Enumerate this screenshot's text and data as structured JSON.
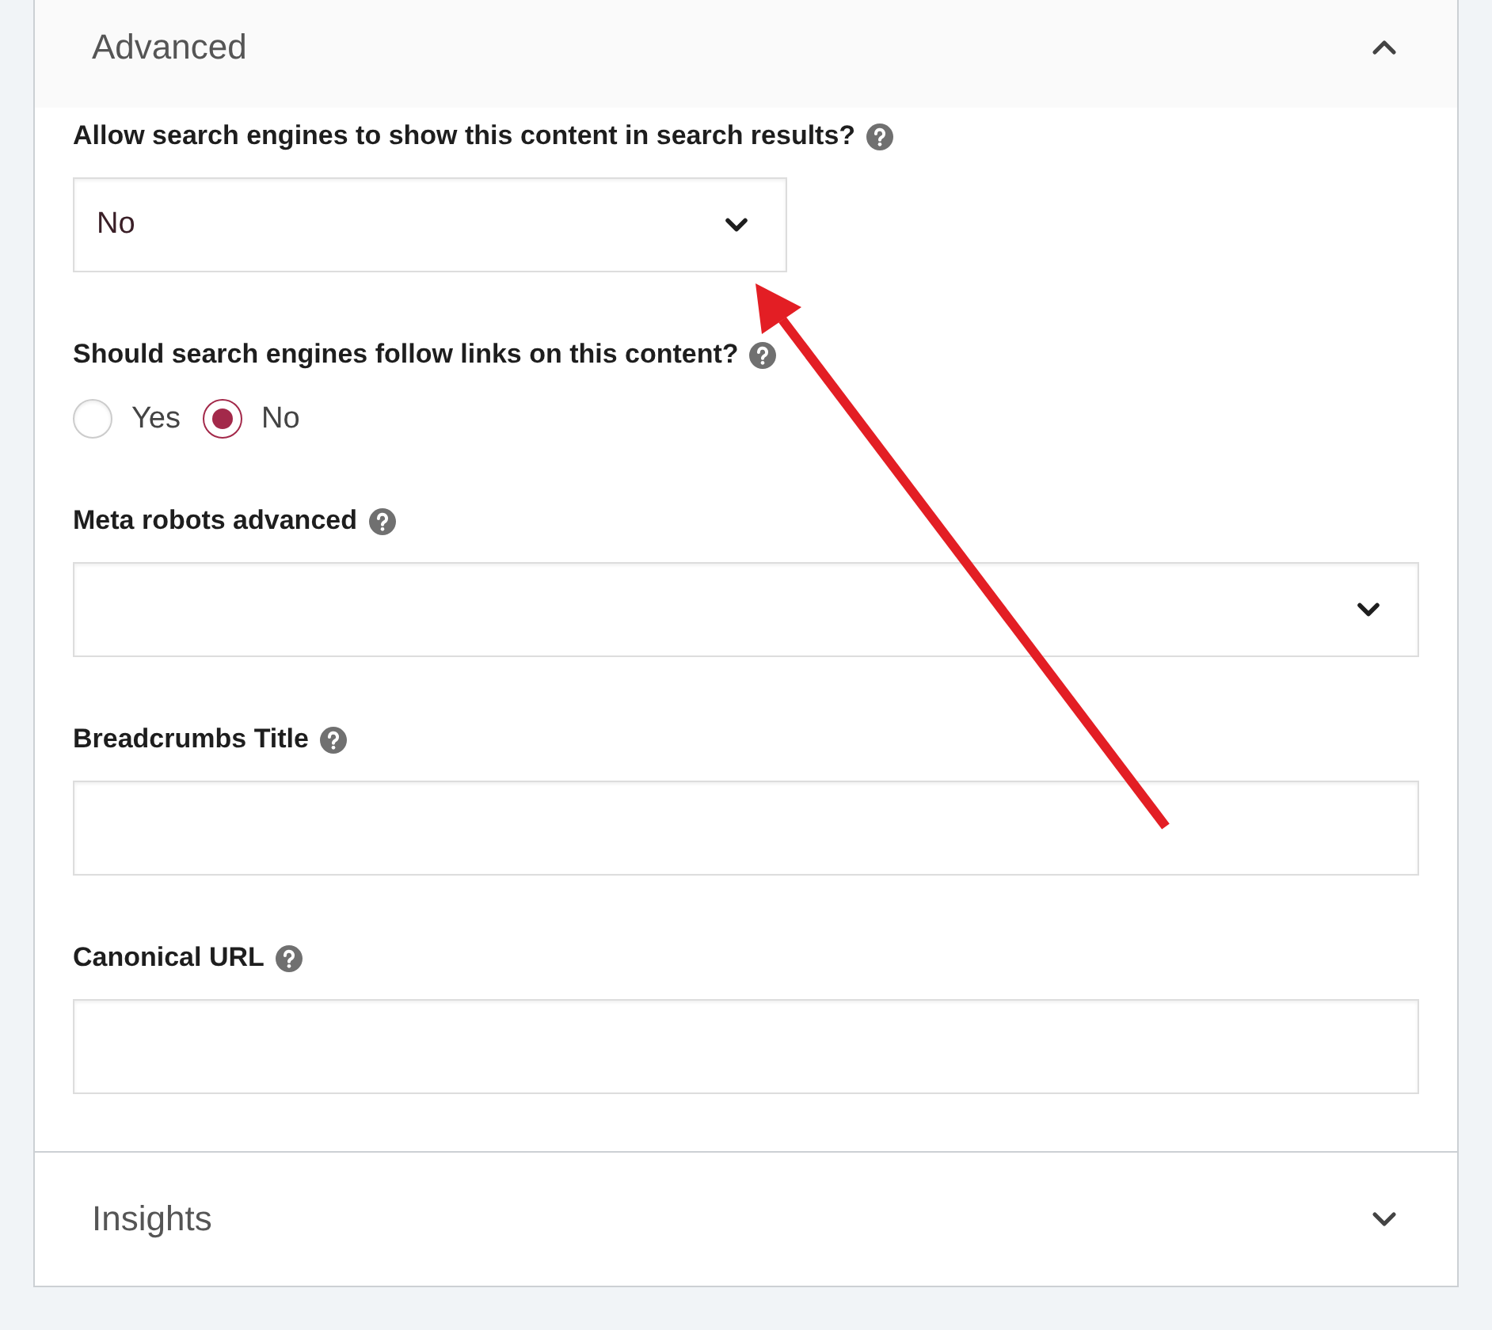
{
  "sections": [
    {
      "title": "Advanced",
      "expanded": true,
      "fields": [
        {
          "kind": "select",
          "label": "Allow search engines to show this content in search results?",
          "value": "No",
          "compact": true
        },
        {
          "kind": "radio",
          "label": "Should search engines follow links on this content?",
          "options": [
            {
              "label": "Yes",
              "selected": false
            },
            {
              "label": "No",
              "selected": true
            }
          ]
        },
        {
          "kind": "select",
          "label": "Meta robots advanced",
          "compact": false
        },
        {
          "kind": "text",
          "label": "Breadcrumbs Title"
        },
        {
          "kind": "text",
          "label": "Canonical URL"
        }
      ]
    },
    {
      "title": "Insights",
      "expanded": false
    }
  ]
}
